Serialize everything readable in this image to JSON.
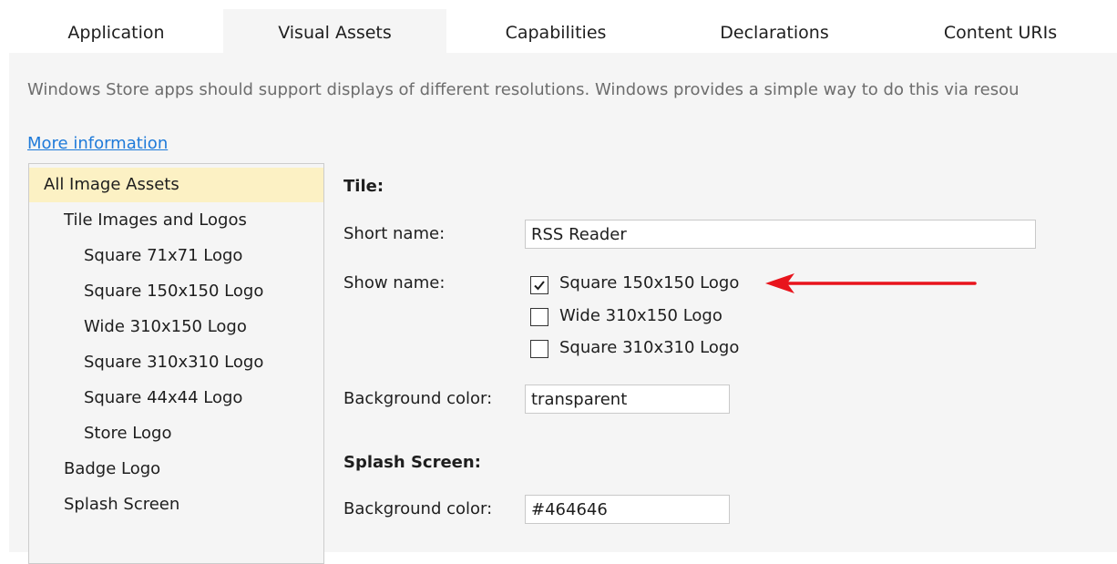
{
  "tabs": [
    {
      "label": "Application",
      "active": false
    },
    {
      "label": "Visual Assets",
      "active": true
    },
    {
      "label": "Capabilities",
      "active": false
    },
    {
      "label": "Declarations",
      "active": false
    },
    {
      "label": "Content URIs",
      "active": false
    }
  ],
  "intro_text": "Windows Store apps should support displays of different resolutions. Windows provides a simple way to do this via resou",
  "more_info_link": "More information",
  "asset_tree": [
    {
      "label": "All Image Assets",
      "selected": true
    },
    {
      "label": "Tile Images and Logos"
    },
    {
      "label": "Square 71x71 Logo"
    },
    {
      "label": "Square 150x150 Logo"
    },
    {
      "label": "Wide 310x150 Logo"
    },
    {
      "label": "Square 310x310 Logo"
    },
    {
      "label": "Square 44x44 Logo"
    },
    {
      "label": "Store Logo"
    },
    {
      "label": "Badge Logo"
    },
    {
      "label": "Splash Screen"
    }
  ],
  "tile": {
    "heading": "Tile:",
    "short_name_label": "Short name:",
    "short_name_value": "RSS Reader",
    "show_name_label": "Show name:",
    "show_name_options": [
      {
        "label": "Square 150x150 Logo",
        "checked": true
      },
      {
        "label": "Wide 310x150 Logo",
        "checked": false
      },
      {
        "label": "Square 310x310 Logo",
        "checked": false
      }
    ],
    "background_color_label": "Background color:",
    "background_color_value": "transparent"
  },
  "splash": {
    "heading": "Splash Screen:",
    "background_color_label": "Background color:",
    "background_color_value": "#464646"
  },
  "colors": {
    "panel_background": "#f5f5f5",
    "selected_item": "#fcf1c4",
    "link": "#1e7ad9",
    "annotation_arrow": "#e8141c"
  },
  "annotation": "red-arrow-icon"
}
